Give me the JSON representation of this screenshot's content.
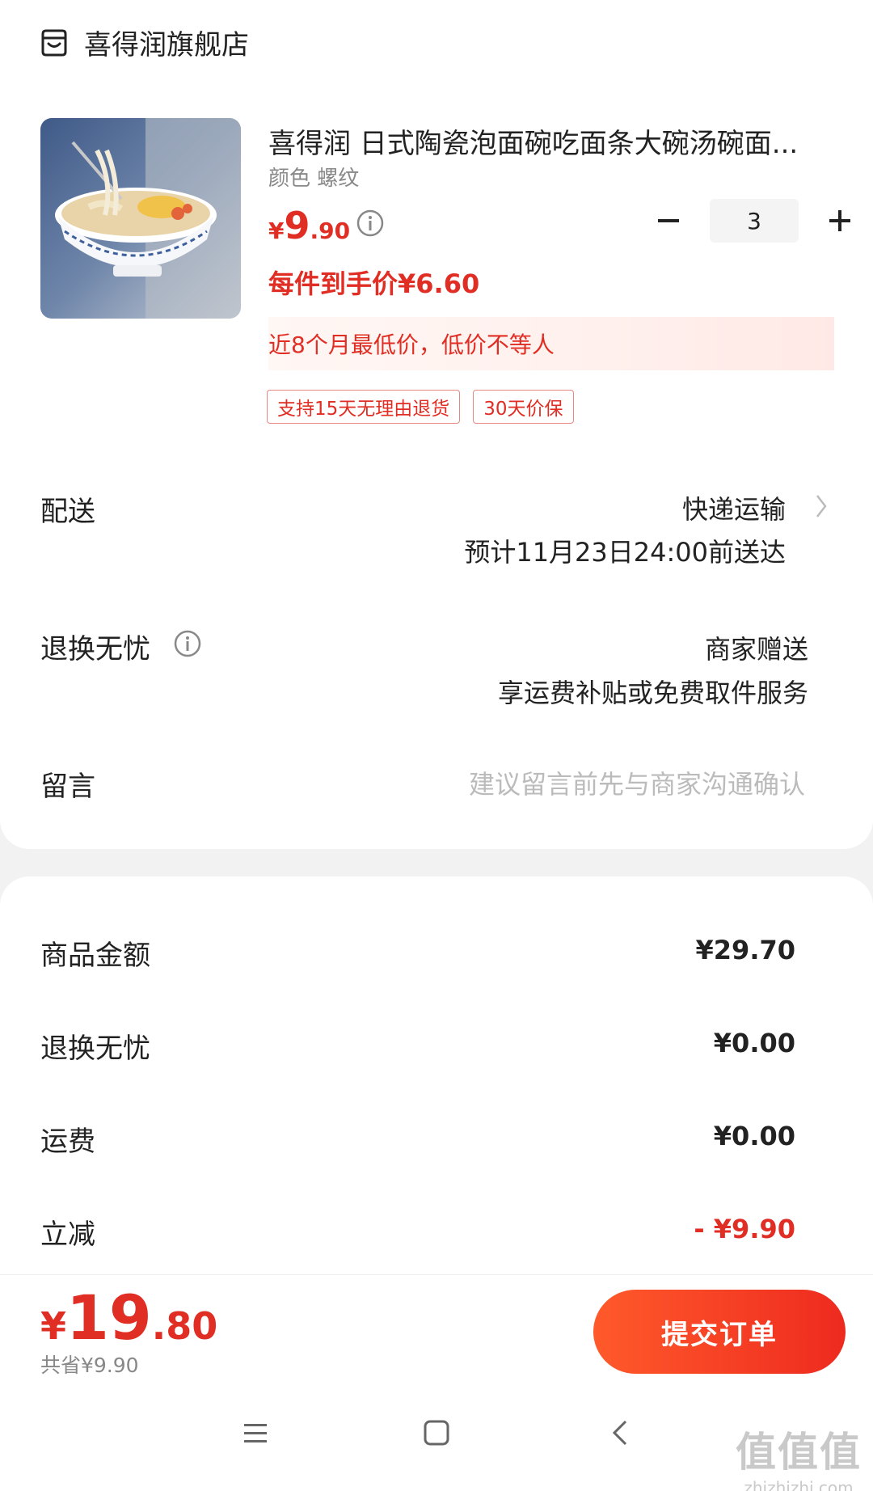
{
  "store": {
    "name": "喜得润旗舰店",
    "icon": "store-icon"
  },
  "product": {
    "title": "喜得润 日式陶瓷泡面碗吃面条大碗汤碗面...",
    "variant": "颜色 螺纹",
    "price_yen": "¥",
    "price_int": "9",
    "price_dec": ".90",
    "unit_price": "每件到手价¥6.60",
    "quantity": "3",
    "lowest_note": "近8个月最低价，低价不等人",
    "tags": [
      "支持15天无理由退货",
      "30天价保"
    ]
  },
  "shipping": {
    "label": "配送",
    "method": "快递运输",
    "eta": "预计11月23日24:00前送达"
  },
  "returns": {
    "label": "退换无忧",
    "line1": "商家赠送",
    "line2": "享运费补贴或免费取件服务"
  },
  "message": {
    "label": "留言",
    "placeholder": "建议留言前先与商家沟通确认"
  },
  "summary": [
    {
      "label": "商品金额",
      "value": "¥29.70"
    },
    {
      "label": "退换无忧",
      "value": "¥0.00"
    },
    {
      "label": "运费",
      "value": "¥0.00"
    },
    {
      "label": "立减",
      "value": "- ¥9.90"
    }
  ],
  "footer": {
    "total_yen": "¥",
    "total_int": "19",
    "total_dec": ".80",
    "saved": "共省¥9.90",
    "submit_label": "提交订单"
  },
  "watermark": {
    "big": "值值值",
    "small": "zhizhizhi.com"
  },
  "colors": {
    "accent": "#e02e24",
    "button_start": "#ff5a2b",
    "button_end": "#ee2a1f"
  }
}
